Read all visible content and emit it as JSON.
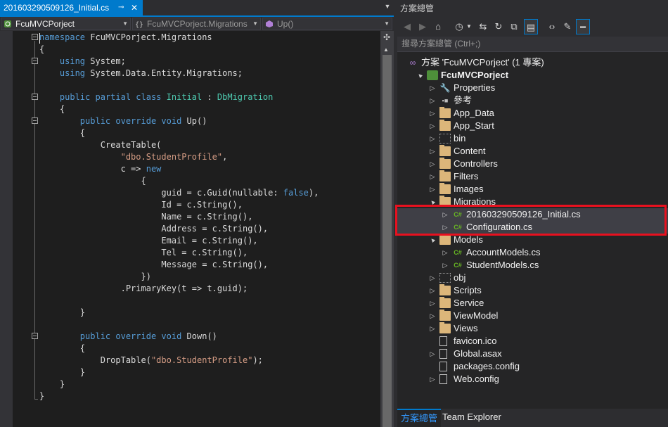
{
  "editor": {
    "tab": {
      "title": "201603290509126_Initial.cs",
      "pin_glyph": "⊸",
      "close_glyph": "✕"
    },
    "navbar": {
      "project": "FcuMVCPorject",
      "class": "FcuMVCPorject.Migrations",
      "member": "Up()"
    },
    "code": [
      "namespace FcuMVCPorject.Migrations",
      "{",
      "    using System;",
      "    using System.Data.Entity.Migrations;",
      "",
      "    public partial class Initial : DbMigration",
      "    {",
      "        public override void Up()",
      "        {",
      "            CreateTable(",
      "                \"dbo.StudentProfile\",",
      "                c => new",
      "                    {",
      "                        guid = c.Guid(nullable: false),",
      "                        Id = c.String(),",
      "                        Name = c.String(),",
      "                        Address = c.String(),",
      "                        Email = c.String(),",
      "                        Tel = c.String(),",
      "                        Message = c.String(),",
      "                    })",
      "                .PrimaryKey(t => t.guid);",
      "",
      "        }",
      "",
      "        public override void Down()",
      "        {",
      "            DropTable(\"dbo.StudentProfile\");",
      "        }",
      "    }",
      "}"
    ]
  },
  "solution_explorer": {
    "title": "方案總管",
    "search_placeholder": "搜尋方案總管 (Ctrl+;)",
    "tree": [
      {
        "label": "方案 'FcuMVCPorject' (1 專案)",
        "icon": "solution-icon",
        "depth": 0,
        "expander": ""
      },
      {
        "label": "FcuMVCPorject",
        "icon": "web-project-icon",
        "depth": 1,
        "expander": "▲",
        "bold": true
      },
      {
        "label": "Properties",
        "icon": "wrench-icon",
        "depth": 2,
        "expander": "▷"
      },
      {
        "label": "參考",
        "icon": "references-icon",
        "depth": 2,
        "expander": "▷"
      },
      {
        "label": "App_Data",
        "icon": "folder-icon",
        "depth": 2,
        "expander": "▷"
      },
      {
        "label": "App_Start",
        "icon": "folder-icon",
        "depth": 2,
        "expander": "▷"
      },
      {
        "label": "bin",
        "icon": "dotted-folder-icon",
        "depth": 2,
        "expander": "▷"
      },
      {
        "label": "Content",
        "icon": "folder-icon",
        "depth": 2,
        "expander": "▷"
      },
      {
        "label": "Controllers",
        "icon": "folder-icon",
        "depth": 2,
        "expander": "▷"
      },
      {
        "label": "Filters",
        "icon": "folder-icon",
        "depth": 2,
        "expander": "▷"
      },
      {
        "label": "Images",
        "icon": "folder-icon",
        "depth": 2,
        "expander": "▷"
      },
      {
        "label": "Migrations",
        "icon": "folder-icon",
        "depth": 2,
        "expander": "▲"
      },
      {
        "label": "201603290509126_Initial.cs",
        "icon": "csharp-file-icon",
        "depth": 3,
        "expander": "▷",
        "selected": true
      },
      {
        "label": "Configuration.cs",
        "icon": "csharp-file-icon",
        "depth": 3,
        "expander": "▷"
      },
      {
        "label": "Models",
        "icon": "folder-icon",
        "depth": 2,
        "expander": "▲"
      },
      {
        "label": "AccountModels.cs",
        "icon": "csharp-file-icon",
        "depth": 3,
        "expander": "▷"
      },
      {
        "label": "StudentModels.cs",
        "icon": "csharp-file-icon",
        "depth": 3,
        "expander": "▷"
      },
      {
        "label": "obj",
        "icon": "dotted-folder-icon",
        "depth": 2,
        "expander": "▷"
      },
      {
        "label": "Scripts",
        "icon": "folder-icon",
        "depth": 2,
        "expander": "▷"
      },
      {
        "label": "Service",
        "icon": "folder-icon",
        "depth": 2,
        "expander": "▷"
      },
      {
        "label": "ViewModel",
        "icon": "folder-icon",
        "depth": 2,
        "expander": "▷"
      },
      {
        "label": "Views",
        "icon": "folder-icon",
        "depth": 2,
        "expander": "▷"
      },
      {
        "label": "favicon.ico",
        "icon": "file-icon",
        "depth": 2,
        "expander": ""
      },
      {
        "label": "Global.asax",
        "icon": "file-icon",
        "depth": 2,
        "expander": "▷"
      },
      {
        "label": "packages.config",
        "icon": "file-icon",
        "depth": 2,
        "expander": ""
      },
      {
        "label": "Web.config",
        "icon": "file-icon",
        "depth": 2,
        "expander": "▷"
      }
    ],
    "bottom_tabs": {
      "solution": "方案總管",
      "team": "Team Explorer"
    }
  },
  "colors": {
    "accent": "#007acc",
    "highlight_box": "#e8111f",
    "keyword": "#569cd6",
    "type": "#4ec9b0",
    "string": "#d69d85"
  }
}
